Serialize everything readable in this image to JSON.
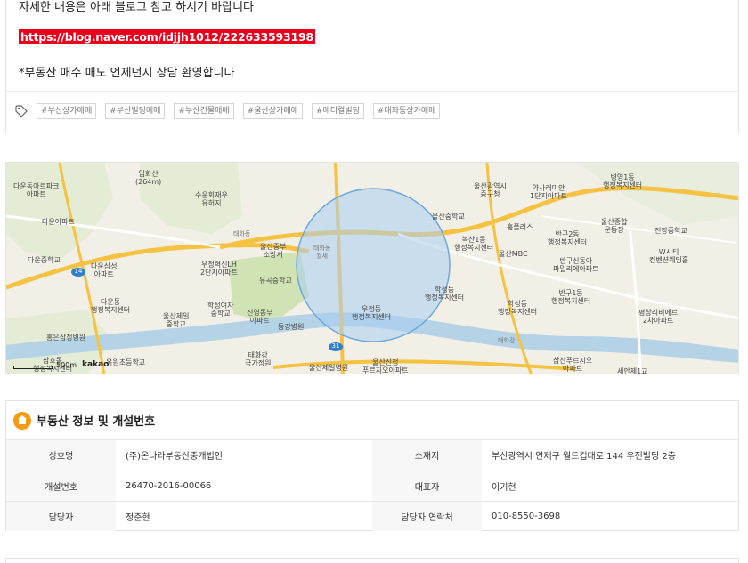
{
  "description": {
    "line1": "자세한 내용은 아래 블로그 참고 하시기 바랍니다",
    "blog_link": "https://blog.naver.com/idjjh1012/222633593198",
    "line3": "*부동산 매수 매도 언제던지 상담 환영합니다"
  },
  "tags": [
    "#부산상가매매",
    "#부산빌딩매매",
    "#부산건물매매",
    "#울산상가매매",
    "#메디컬빌딩",
    "#태화동상가매매"
  ],
  "map": {
    "labels": {
      "ipwha": "입화산\n(264m)",
      "daun_apt": "다운동아르파크\n아파트",
      "daun_apt2": "다운아파트",
      "daun_school": "다운중학교",
      "dasan": "다운삼성\n아파트",
      "suun": "수운회재우\n유허지",
      "taehwa": "태화동",
      "fire": "울산중부\n소방서",
      "center_circle": "태화동\n월세",
      "hakseong": "학성여자\n중학교",
      "woojeong_lh": "우정혁신LH\n2단지아파트",
      "wgok_school": "유곡중학교",
      "daun_center": "다운동\n행정복지센터",
      "ulsan_jeil": "울산제일\n중학교",
      "jindong": "진영동부\n아파트",
      "donggang": "동강병원",
      "hongun": "홍은삼정병원",
      "samho": "삼호동\n행정복지센터",
      "okwon": "옥원초등학교",
      "taehwa_bridge": "태화강\n국가정원",
      "jeil_hospital": "울산제일병원",
      "ulsan_city": "울산광역시\n중구청",
      "yaksa": "약사래미안\n1단지아파트",
      "byeongyeong": "병영1동\n행정복지센터",
      "ulsan_school": "울산중학교",
      "bogsan": "복산1동\n행정복지센터",
      "homeplus": "홈플러스",
      "bangu2": "반구2동\n행정복지센터",
      "stadium": "울산종합\n운동장",
      "jinjang": "진장중학교",
      "mbc": "울산MBC",
      "bangu_apt": "반구신동아\n파밀리에아파트",
      "wasi": "W시티\n컨벤션웨딩홀",
      "woojeong": "우정동\n행정복지센터",
      "hakseong2": "학성동\n행정복지센터",
      "bangu1": "반구1동\n행정복지센터",
      "pyeongri": "평창리비에르\n2차아파트",
      "taehwa_river": "태화강",
      "samsanjeongwon": "삼산푸르지오\n아파트",
      "ulsan_sinjeong": "울산신정\n푸르지오아파트",
      "seian": "세안제1교",
      "kakao": "kakao",
      "scale": "500m",
      "road14": "14",
      "road31": "31"
    }
  },
  "info": {
    "title": "부동산 정보 및 개설번호",
    "rows": [
      {
        "k1": "상호명",
        "v1": "(주)온나라부동산중개법인",
        "k2": "소재지",
        "v2": "부산광역시 연제구 월드컵대로 144 우전빌딩 2층"
      },
      {
        "k1": "개설번호",
        "v1": "26470-2016-00066",
        "k2": "대표자",
        "v2": "이기현"
      },
      {
        "k1": "담당자",
        "v1": "정준현",
        "k2": "담당자 연락처",
        "v2": "010-8550-3698"
      }
    ]
  },
  "colors": {
    "link_bg": "#e8001c",
    "accent_orange": "#f39c12",
    "circle_fill": "#a9cdf0",
    "road_yellow": "#f5c242",
    "river": "#b5d3e7",
    "park": "#cfe3b4"
  }
}
